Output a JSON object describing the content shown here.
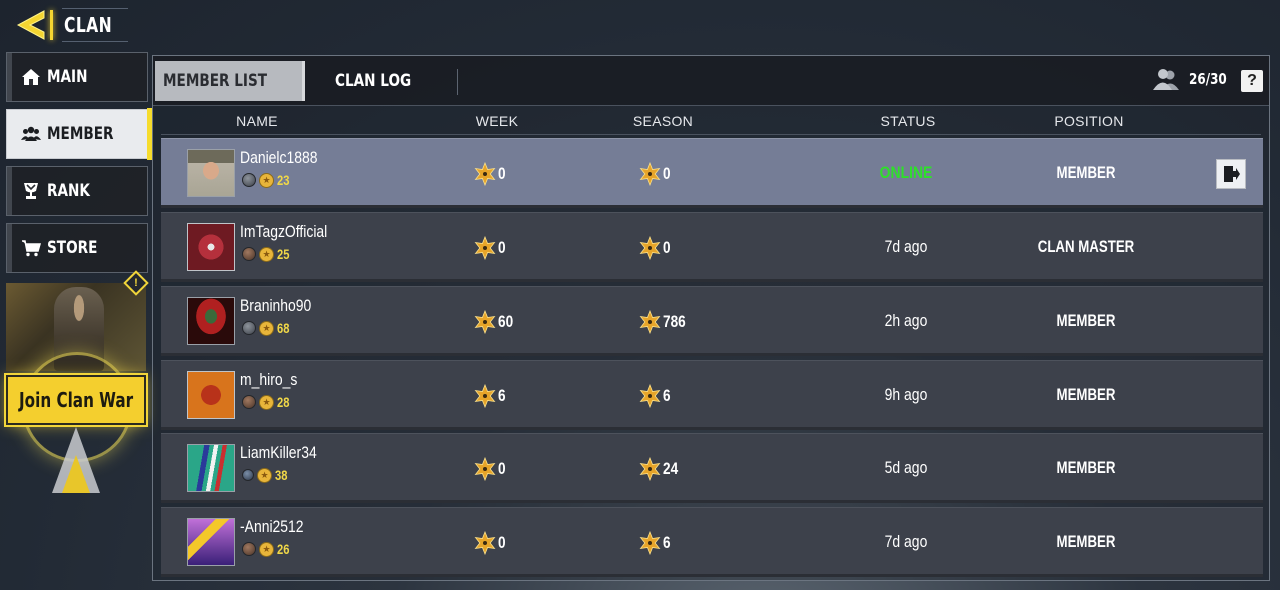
{
  "header": {
    "title": "CLAN",
    "back_icon": "back-arrow-icon"
  },
  "sidebar": {
    "items": [
      {
        "label": "MAIN",
        "icon": "home-icon",
        "active": false
      },
      {
        "label": "MEMBER",
        "icon": "members-icon",
        "active": true
      },
      {
        "label": "RANK",
        "icon": "trophy-icon",
        "active": false
      },
      {
        "label": "STORE",
        "icon": "cart-icon",
        "active": false
      }
    ],
    "clan_war": {
      "button_label": "Join Clan War",
      "alert_icon": "!"
    }
  },
  "tabs": [
    {
      "label": "MEMBER LIST",
      "active": true
    },
    {
      "label": "CLAN LOG",
      "active": false
    }
  ],
  "member_count": "26/30",
  "help_label": "?",
  "columns": [
    "NAME",
    "WEEK",
    "SEASON",
    "STATUS",
    "POSITION"
  ],
  "colors": {
    "accent": "#f4cf2e",
    "online": "#2ee02a",
    "level": "#f1d848",
    "selected_row": "#757d96"
  },
  "members": [
    {
      "name": "Danielc1888",
      "level": "23",
      "week": "0",
      "season": "0",
      "status": "ONLINE",
      "position": "MEMBER",
      "selected": true
    },
    {
      "name": "ImTagzOfficial",
      "level": "25",
      "week": "0",
      "season": "0",
      "status": "7d ago",
      "position": "CLAN MASTER",
      "selected": false
    },
    {
      "name": "Braninho90",
      "level": "68",
      "week": "60",
      "season": "786",
      "status": "2h ago",
      "position": "MEMBER",
      "selected": false
    },
    {
      "name": "m_hiro_s",
      "level": "28",
      "week": "6",
      "season": "6",
      "status": "9h ago",
      "position": "MEMBER",
      "selected": false
    },
    {
      "name": "LiamKiller34",
      "level": "38",
      "week": "0",
      "season": "24",
      "status": "5d ago",
      "position": "MEMBER",
      "selected": false
    },
    {
      "name": "-Anni2512",
      "level": "26",
      "week": "0",
      "season": "6",
      "status": "7d ago",
      "position": "MEMBER",
      "selected": false
    }
  ]
}
